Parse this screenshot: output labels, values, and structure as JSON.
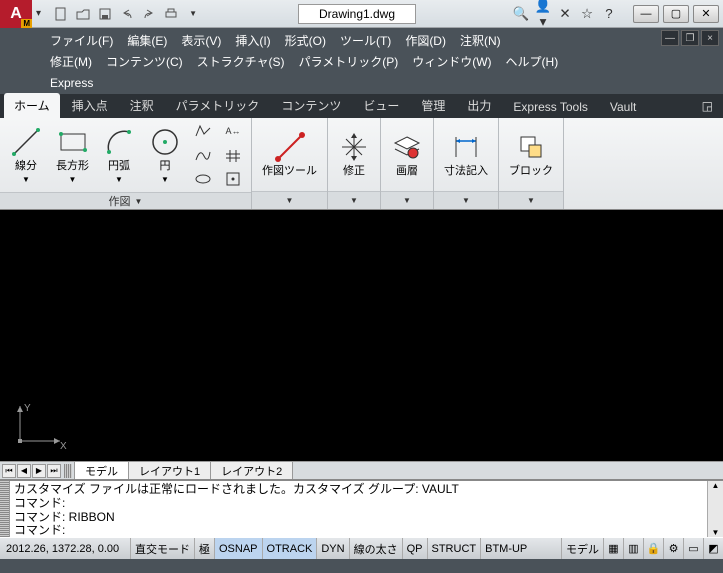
{
  "titlebar": {
    "filename": "Drawing1.dwg"
  },
  "menus": {
    "file": "ファイル(F)",
    "edit": "編集(E)",
    "view": "表示(V)",
    "insert": "挿入(I)",
    "format": "形式(O)",
    "tools": "ツール(T)",
    "draw": "作図(D)",
    "annotate": "注釈(N)",
    "modify": "修正(M)",
    "content": "コンテンツ(C)",
    "structure": "ストラクチャ(S)",
    "parametric": "パラメトリック(P)",
    "window": "ウィンドウ(W)",
    "help": "ヘルプ(H)",
    "express": "Express"
  },
  "tabs": {
    "home": "ホーム",
    "insert": "挿入点",
    "annotate": "注釈",
    "parametric": "パラメトリック",
    "content": "コンテンツ",
    "view": "ビュー",
    "manage": "管理",
    "output": "出力",
    "express": "Express Tools",
    "vault": "Vault"
  },
  "ribbon": {
    "line": "線分",
    "rectangle": "長方形",
    "arc": "円弧",
    "circle": "円",
    "panel_draw": "作図",
    "drawtools": "作図ツール",
    "modify": "修正",
    "layer": "画層",
    "dim": "寸法記入",
    "block": "ブロック"
  },
  "layout": {
    "model": "モデル",
    "l1": "レイアウト1",
    "l2": "レイアウト2"
  },
  "cmd": {
    "l1": "カスタマイズ ファイルは正常にロードされました。カスタマイズ グループ: VAULT",
    "l2": "コマンド:",
    "l3": "コマンド: RIBBON",
    "l4": "コマンド:"
  },
  "status": {
    "coords": "2012.26, 1372.28, 0.00",
    "ortho": "直交モード",
    "polar": "極",
    "osnap": "OSNAP",
    "otrack": "OTRACK",
    "dyn": "DYN",
    "lwt": "線の太さ",
    "qp": "QP",
    "struct": "STRUCT",
    "btm": "BTM-UP",
    "model": "モデル"
  }
}
